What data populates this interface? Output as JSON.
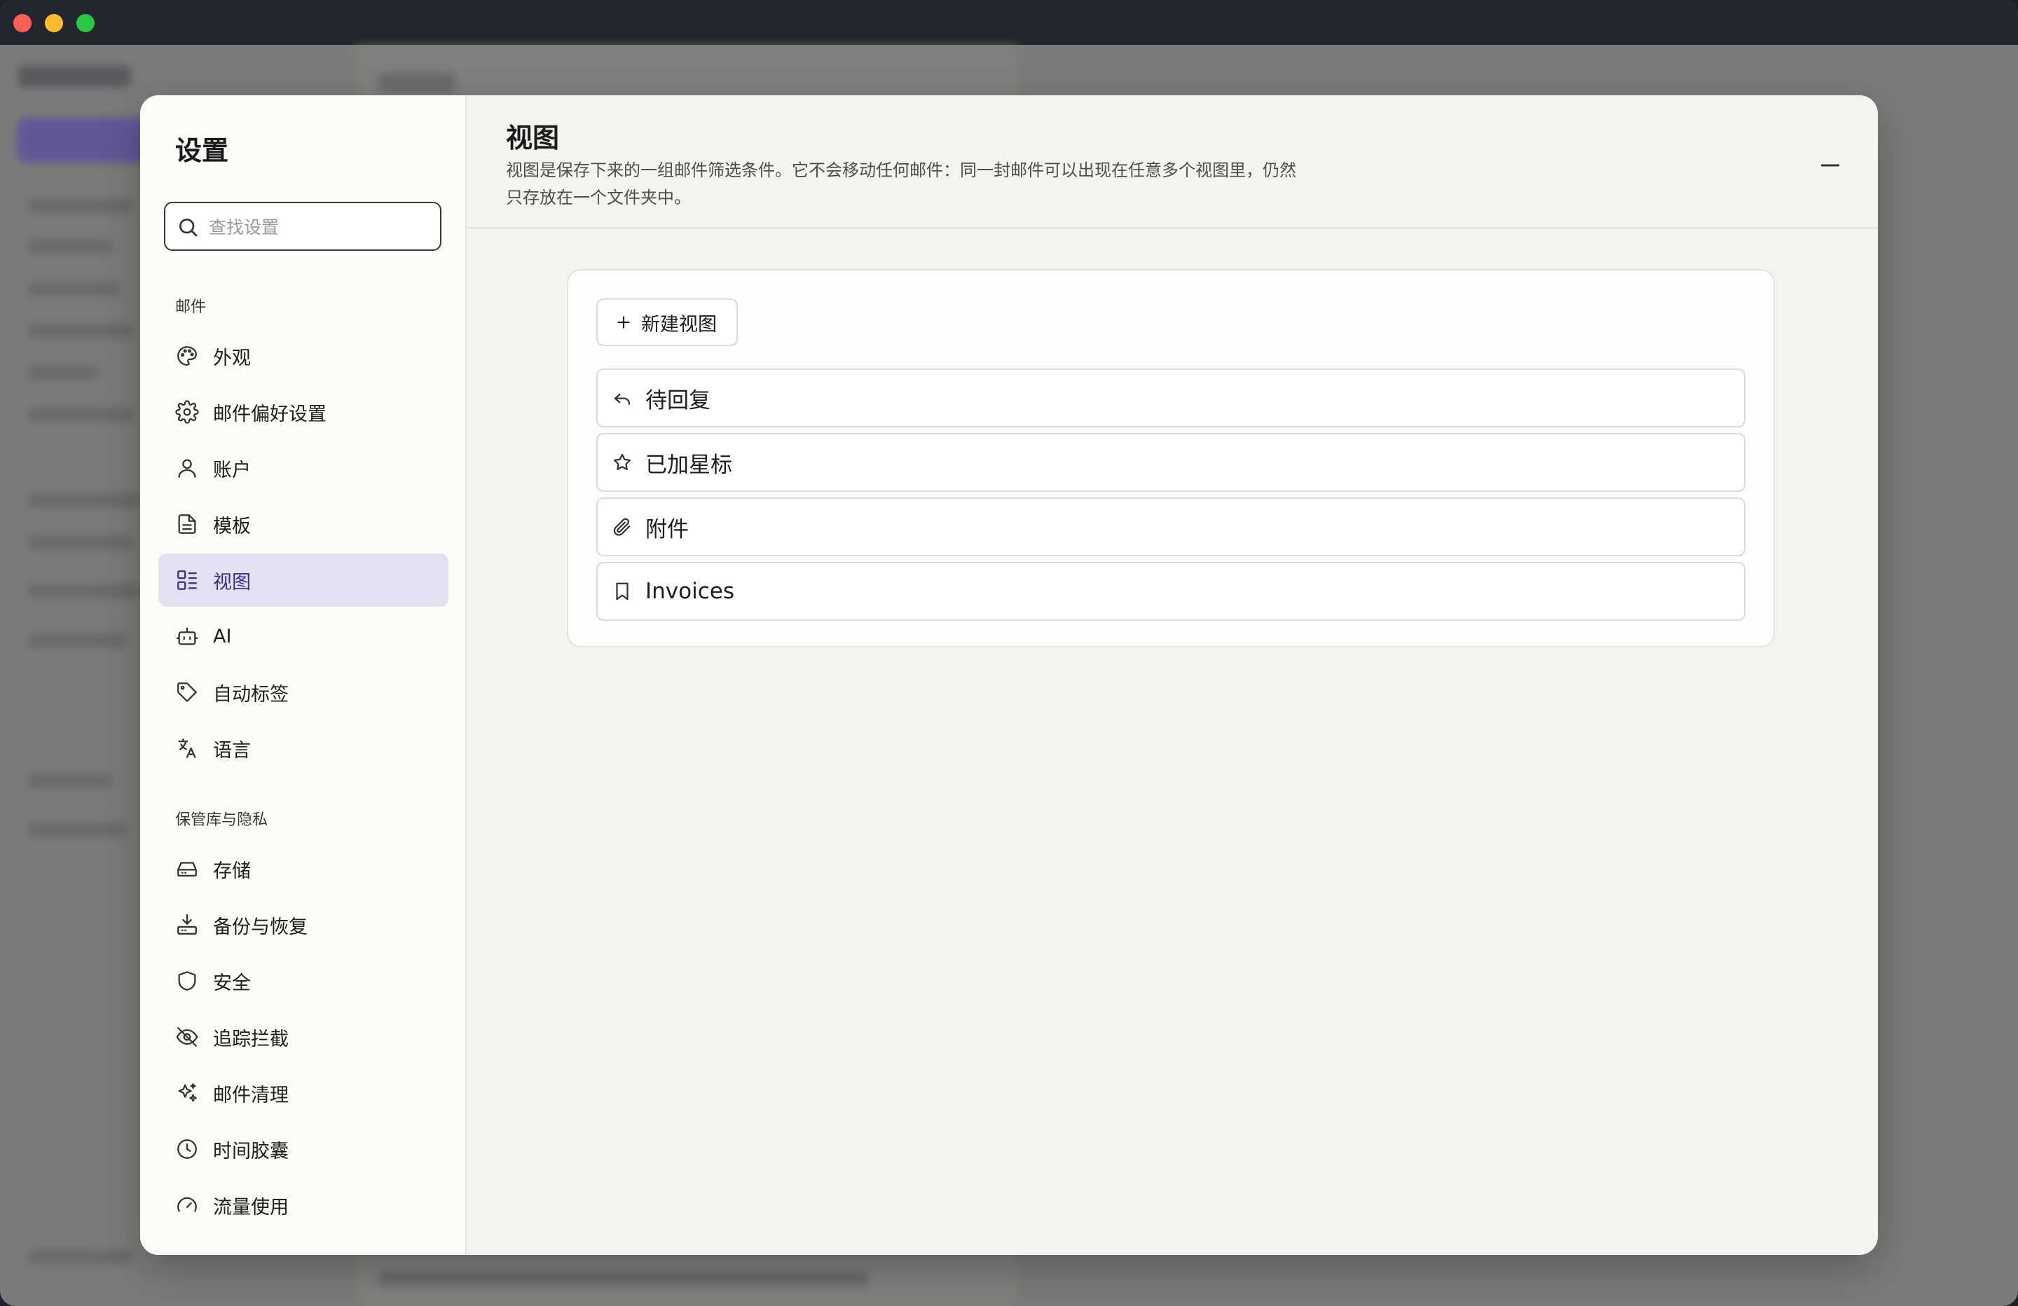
{
  "settings": {
    "title": "设置",
    "search_placeholder": "查找设置",
    "sections": [
      {
        "label": "邮件",
        "items": [
          {
            "label": "外观",
            "icon": "palette-icon"
          },
          {
            "label": "邮件偏好设置",
            "icon": "gear-icon"
          },
          {
            "label": "账户",
            "icon": "user-icon"
          },
          {
            "label": "模板",
            "icon": "document-icon"
          },
          {
            "label": "视图",
            "icon": "views-icon",
            "active": true
          },
          {
            "label": "AI",
            "icon": "bot-icon"
          },
          {
            "label": "自动标签",
            "icon": "tag-icon"
          },
          {
            "label": "语言",
            "icon": "translate-icon"
          }
        ]
      },
      {
        "label": "保管库与隐私",
        "items": [
          {
            "label": "存储",
            "icon": "drive-icon"
          },
          {
            "label": "备份与恢复",
            "icon": "backup-icon"
          },
          {
            "label": "安全",
            "icon": "shield-icon"
          },
          {
            "label": "追踪拦截",
            "icon": "eye-off-icon"
          },
          {
            "label": "邮件清理",
            "icon": "sparkles-icon"
          },
          {
            "label": "时间胶囊",
            "icon": "clock-icon"
          },
          {
            "label": "流量使用",
            "icon": "gauge-icon"
          }
        ]
      }
    ]
  },
  "page": {
    "title": "视图",
    "description": "视图是保存下来的一组邮件筛选条件。它不会移动任何邮件：同一封邮件可以出现在任意多个视图里，仍然只存放在一个文件夹中。"
  },
  "views": {
    "new_button_label": "新建视图",
    "items": [
      {
        "label": "待回复",
        "icon": "reply-icon"
      },
      {
        "label": "已加星标",
        "icon": "star-icon"
      },
      {
        "label": "附件",
        "icon": "paperclip-icon"
      },
      {
        "label": "Invoices",
        "icon": "bookmark-icon"
      }
    ]
  },
  "colors": {
    "accent": "#3a2f8c",
    "active_bg": "#e4e0f2",
    "modal_bg": "#f4f3ef",
    "sidebar_bg": "#fbfbf8"
  }
}
